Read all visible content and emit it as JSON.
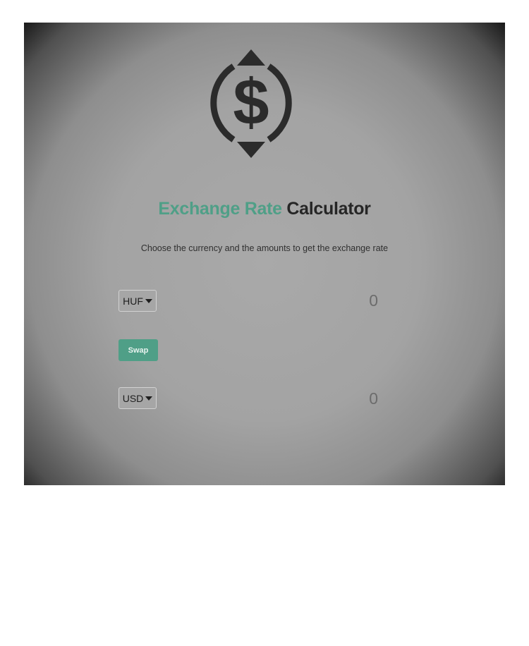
{
  "app": {
    "title_accent": "Exchange Rate",
    "title_rest": "Calculator",
    "subtitle": "Choose the currency and the amounts to get the exchange rate",
    "logo_icon": "dollar-exchange-icon"
  },
  "currency_one": {
    "code": "HUF",
    "amount": "0"
  },
  "swap": {
    "label": "Swap"
  },
  "currency_two": {
    "code": "USD",
    "amount": "0"
  },
  "colors": {
    "accent": "#4f9f87",
    "dark_text": "#262626"
  }
}
